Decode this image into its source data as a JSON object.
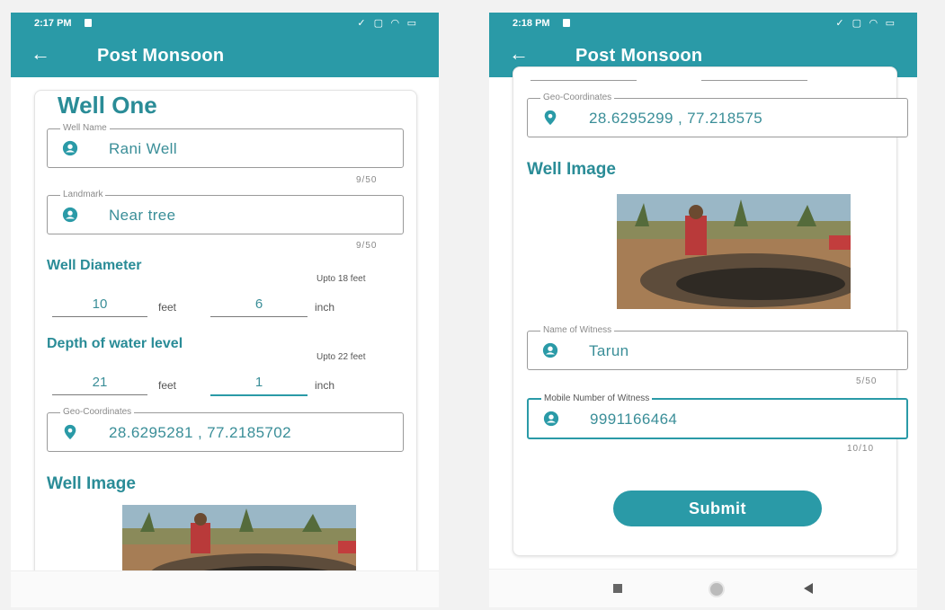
{
  "colors": {
    "primary": "#2a9aa7",
    "accent_text": "#2a8c97"
  },
  "left": {
    "status": {
      "time": "2:17 PM"
    },
    "appbar": {
      "title": "Post Monsoon",
      "back_icon": "arrow-left-icon"
    },
    "card_title": "Well One",
    "well_name": {
      "label": "Well Name",
      "value": "Rani Well",
      "counter": "9/50",
      "icon": "person-icon"
    },
    "landmark": {
      "label": "Landmark",
      "value": "Near tree",
      "counter": "9/50",
      "icon": "person-icon"
    },
    "diameter": {
      "heading": "Well Diameter",
      "limit": "Upto 18 feet",
      "feet": "10",
      "feet_unit": "feet",
      "inch": "6",
      "inch_unit": "inch"
    },
    "depth": {
      "heading": "Depth of water level",
      "limit": "Upto 22 feet",
      "feet": "21",
      "feet_unit": "feet",
      "inch": "1",
      "inch_unit": "inch"
    },
    "geo": {
      "label": "Geo-Coordinates",
      "value": "28.6295281 , 77.2185702",
      "icon": "location-pin-icon"
    },
    "image_heading": "Well Image"
  },
  "right": {
    "status": {
      "time": "2:18 PM"
    },
    "appbar": {
      "title": "Post Monsoon",
      "back_icon": "arrow-left-icon"
    },
    "geo": {
      "label": "Geo-Coordinates",
      "value": "28.6295299 , 77.218575",
      "icon": "location-pin-icon"
    },
    "image_heading": "Well Image",
    "witness": {
      "label": "Name of Witness",
      "value": "Tarun",
      "counter": "5/50",
      "icon": "person-icon"
    },
    "mobile": {
      "label": "Mobile Number of Witness",
      "value": "9991166464",
      "counter": "10/10",
      "icon": "person-icon"
    },
    "submit_label": "Submit",
    "nav_icons": [
      "recent-apps-icon",
      "home-icon",
      "back-triangle-icon"
    ]
  }
}
